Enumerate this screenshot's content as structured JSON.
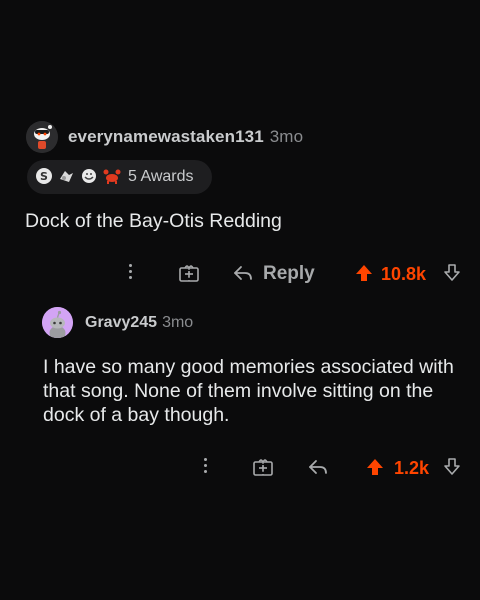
{
  "comments": [
    {
      "username": "everynamewastaken131",
      "age": "3mo",
      "awards_label": "5 Awards",
      "body": "Dock of the Bay-Otis Redding",
      "reply_label": "Reply",
      "votes": "10.8k"
    },
    {
      "username": "Gravy245",
      "age": "3mo",
      "body": "I have so many good memories associated with that song. None of them involve sitting on the dock of a bay though.",
      "votes": "1.2k"
    }
  ],
  "colors": {
    "background": "#0b0b0c",
    "upvote_orange": "#ff4500",
    "text_primary": "#e7e9ea",
    "text_secondary": "#8a8c8f",
    "avatar2_bg": "#d3a4f5"
  },
  "icons": [
    "snoo-avatar-icon",
    "silver-award-icon",
    "helpful-award-icon",
    "wholesome-award-icon",
    "crab-award-icon",
    "more-options-icon",
    "give-award-icon",
    "reply-icon",
    "upvote-icon",
    "downvote-icon"
  ]
}
